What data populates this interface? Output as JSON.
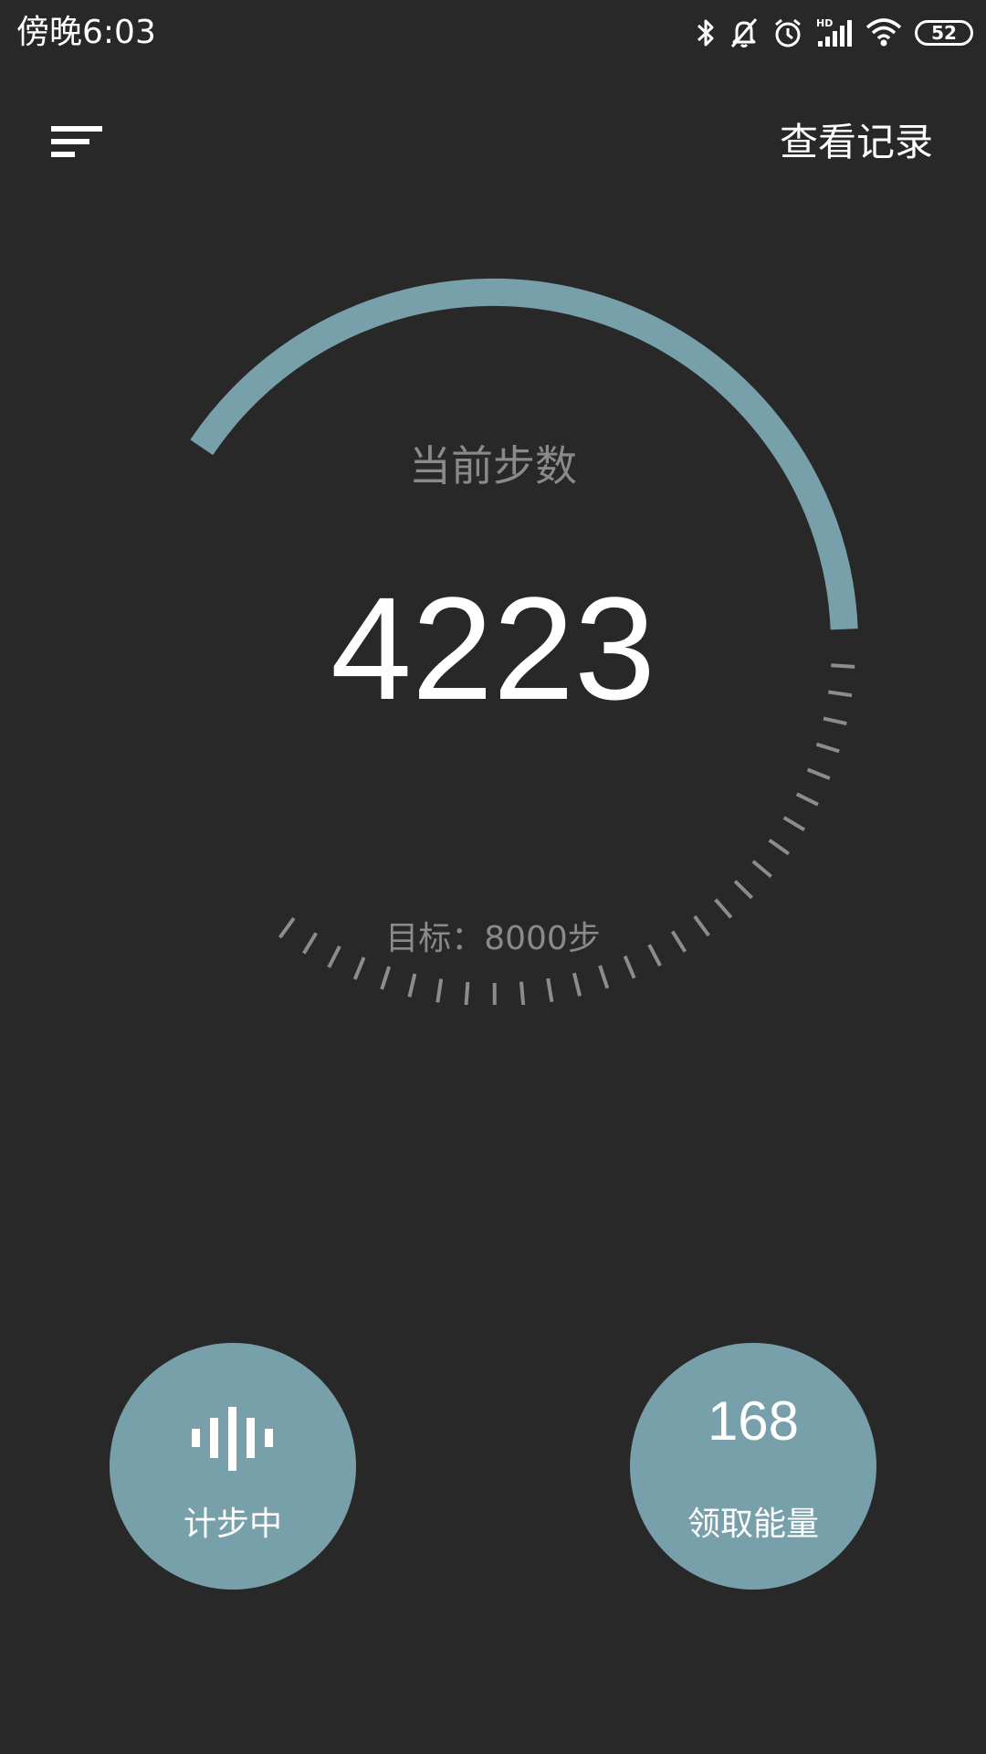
{
  "status_bar": {
    "time": "傍晚6:03",
    "battery_level": "52",
    "icons": [
      "bluetooth-icon",
      "notifications-off-icon",
      "alarm-icon",
      "hd-signal-icon",
      "wifi-icon",
      "battery-icon"
    ]
  },
  "header": {
    "menu_icon": "sort-menu-icon",
    "history_label": "查看记录"
  },
  "pedometer": {
    "label": "当前步数",
    "steps": "4223",
    "goal_text": "目标：8000步",
    "progress": 0.5279,
    "accent_color": "#78a0ab",
    "tick_color": "#8c8c8c"
  },
  "actions": {
    "counting": {
      "label": "计步中",
      "icon": "sound-wave-icon"
    },
    "energy": {
      "value": "168",
      "label": "领取能量"
    }
  },
  "colors": {
    "background": "#282828",
    "accent": "#78a0ab",
    "muted_text": "#8a8a8a"
  }
}
